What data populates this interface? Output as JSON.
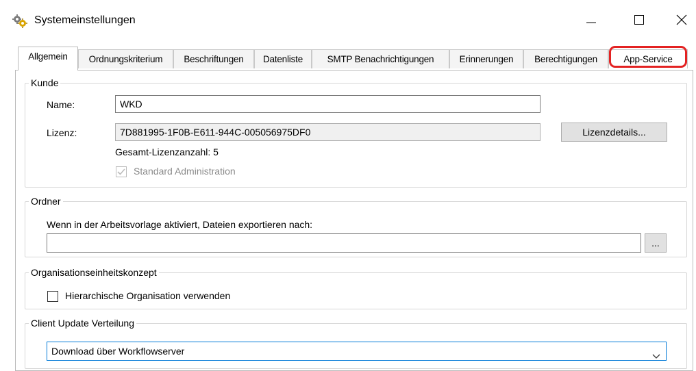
{
  "window": {
    "title": "Systemeinstellungen",
    "icon": "gears-icon",
    "controls": {
      "minimize": "minimize-icon",
      "maximize": "maximize-icon",
      "close": "close-icon"
    }
  },
  "tabs": [
    {
      "label": "Allgemein",
      "active": true
    },
    {
      "label": "Ordnungskriterium",
      "active": false
    },
    {
      "label": "Beschriftungen",
      "active": false
    },
    {
      "label": "Datenliste",
      "active": false
    },
    {
      "label": "SMTP Benachrichtigungen",
      "active": false
    },
    {
      "label": "Erinnerungen",
      "active": false
    },
    {
      "label": "Berechtigungen",
      "active": false
    },
    {
      "label": "App-Service",
      "active": false,
      "highlighted": true
    }
  ],
  "highlight_color": "#e32222",
  "kunde": {
    "legend": "Kunde",
    "name_label": "Name:",
    "name_value": "WKD",
    "lizenz_label": "Lizenz:",
    "lizenz_value": "7D881995-1F0B-E611-944C-005056975DF0",
    "lizenzdetails_button": "Lizenzdetails...",
    "gesamt_lizenzen": "Gesamt-Lizenzanzahl: 5",
    "standard_admin_label": "Standard Administration",
    "standard_admin_checked": true,
    "standard_admin_disabled": true
  },
  "ordner": {
    "legend": "Ordner",
    "description": "Wenn in der Arbeitsvorlage aktiviert, Dateien exportieren nach:",
    "path_value": "",
    "browse_button": "..."
  },
  "orgkonzept": {
    "legend": "Organisationseinheitskonzept",
    "hierarchisch_label": "Hierarchische Organisation verwenden",
    "hierarchisch_checked": false
  },
  "client_update": {
    "legend": "Client Update Verteilung",
    "selected": "Download über Workflowserver"
  }
}
